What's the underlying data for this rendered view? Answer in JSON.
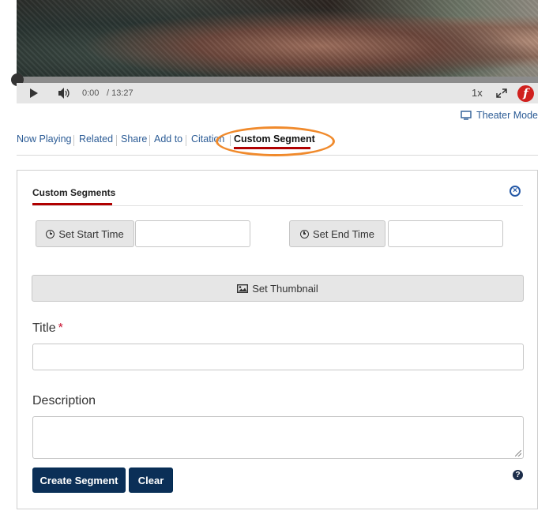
{
  "player": {
    "current_time": "0:00",
    "total_time": "/ 13:27",
    "speed": "1x",
    "progress_fraction": 0.0,
    "logo_letter": "f",
    "icons": [
      "play-icon",
      "volume-icon",
      "fullscreen-icon",
      "brand-logo"
    ]
  },
  "theater": {
    "label": "Theater Mode",
    "icon": "monitor-icon"
  },
  "tabs": [
    {
      "label": "Now Playing"
    },
    {
      "label": "Related"
    },
    {
      "label": "Share"
    },
    {
      "label": "Add to"
    },
    {
      "label": "Citation"
    },
    {
      "label": "Custom Segment",
      "active": true
    }
  ],
  "panel": {
    "tab_label": "Custom Segments",
    "set_start_label": "Set Start Time",
    "set_end_label": "Set End Time",
    "start_value": "",
    "end_value": "",
    "set_thumbnail_label": "Set Thumbnail",
    "title_label": "Title",
    "required_marker": "*",
    "title_value": "",
    "description_label": "Description",
    "description_value": "",
    "create_label": "Create Segment",
    "clear_label": "Clear",
    "close_glyph": "×",
    "help_glyph": "?"
  },
  "colors": {
    "accent_red": "#b00000",
    "link_blue": "#2b5b95",
    "primary_button": "#0b2f57",
    "highlight_orange": "#f08a2c"
  }
}
